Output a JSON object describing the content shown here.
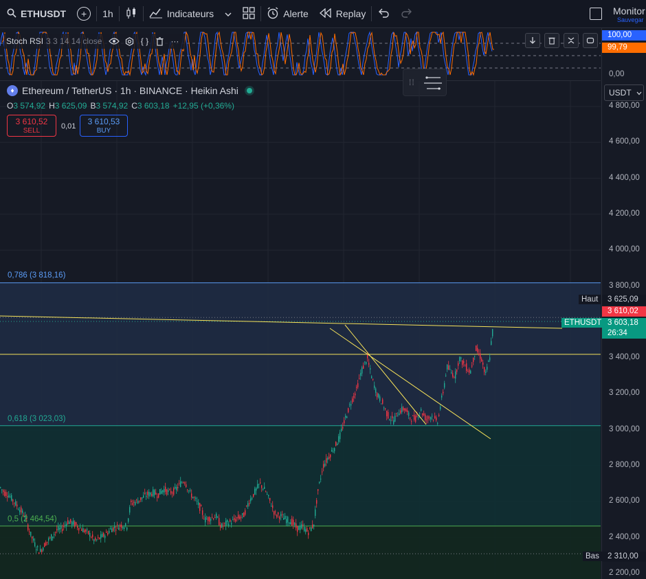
{
  "toolbar": {
    "symbol": "ETHUSDT",
    "interval": "1h",
    "indicators": "Indicateurs",
    "alert": "Alerte",
    "replay": "Replay",
    "monitor": "Monitor",
    "save": "Sauvegar"
  },
  "rsi": {
    "name": "Stoch RSI",
    "params": "3 3 14 14 close",
    "value_k": "100,00",
    "value_d": "99,79",
    "zero": "0,00",
    "k_color": "#2962ff",
    "d_color": "#ff6d00"
  },
  "legend": {
    "title": "Ethereum / TetherUS · 1h · BINANCE · Heikin Ashi",
    "o_label": "O",
    "o": "3 574,92",
    "h_label": "H",
    "h": "3 625,09",
    "b_label": "B",
    "b": "3 574,92",
    "c_label": "C",
    "c": "3 603,18",
    "change": "+12,95 (+0,36%)"
  },
  "trade": {
    "sell_price": "3 610,52",
    "sell_label": "SELL",
    "spread": "0,01",
    "buy_price": "3 610,53",
    "buy_label": "BUY"
  },
  "axis": {
    "currency": "USDT",
    "ticks": [
      "4 800,00",
      "4 600,00",
      "4 400,00",
      "4 200,00",
      "4 000,00",
      "3 800,00",
      "3 400,00",
      "3 200,00",
      "3 000,00",
      "2 800,00",
      "2 600,00",
      "2 400,00",
      "2 200,00"
    ],
    "high_label": "Haut",
    "high_value": "3 625,09",
    "ask_value": "3 610,02",
    "symbol_tag": "ETHUSDT",
    "last_value": "3 603,18",
    "countdown": "26:34",
    "low_label": "Bas",
    "low_value": "2 310,00"
  },
  "fib": {
    "l786": "0,786 (3 818,16)",
    "l618": "0,618 (3 023,03)",
    "l5": "0,5 (2 464,54)"
  },
  "colors": {
    "up": "#22ab94",
    "down": "#f23645",
    "trendline": "#f7e35a",
    "fib786": "#5b9cf6",
    "fib618": "#22ab94",
    "fib5": "#4caf50"
  },
  "chart_data": {
    "type": "candlestick",
    "series_points": [
      [
        0,
        2680
      ],
      [
        6,
        2650
      ],
      [
        12,
        2640
      ],
      [
        20,
        2600
      ],
      [
        28,
        2560
      ],
      [
        36,
        2520
      ],
      [
        44,
        2420
      ],
      [
        52,
        2350
      ],
      [
        58,
        2320
      ],
      [
        66,
        2370
      ],
      [
        74,
        2400
      ],
      [
        82,
        2440
      ],
      [
        90,
        2450
      ],
      [
        98,
        2490
      ],
      [
        106,
        2480
      ],
      [
        114,
        2460
      ],
      [
        122,
        2440
      ],
      [
        130,
        2420
      ],
      [
        138,
        2380
      ],
      [
        146,
        2400
      ],
      [
        154,
        2420
      ],
      [
        162,
        2450
      ],
      [
        170,
        2460
      ],
      [
        178,
        2470
      ],
      [
        184,
        2460
      ],
      [
        190,
        2590
      ],
      [
        198,
        2600
      ],
      [
        206,
        2620
      ],
      [
        214,
        2640
      ],
      [
        222,
        2650
      ],
      [
        230,
        2640
      ],
      [
        238,
        2670
      ],
      [
        246,
        2650
      ],
      [
        254,
        2660
      ],
      [
        262,
        2700
      ],
      [
        268,
        2720
      ],
      [
        276,
        2650
      ],
      [
        284,
        2610
      ],
      [
        292,
        2560
      ],
      [
        298,
        2500
      ],
      [
        306,
        2510
      ],
      [
        314,
        2520
      ],
      [
        322,
        2460
      ],
      [
        330,
        2480
      ],
      [
        338,
        2490
      ],
      [
        346,
        2510
      ],
      [
        354,
        2520
      ],
      [
        362,
        2600
      ],
      [
        370,
        2650
      ],
      [
        378,
        2700
      ],
      [
        386,
        2660
      ],
      [
        394,
        2590
      ],
      [
        400,
        2530
      ],
      [
        408,
        2520
      ],
      [
        416,
        2500
      ],
      [
        424,
        2490
      ],
      [
        432,
        2450
      ],
      [
        440,
        2460
      ],
      [
        448,
        2430
      ],
      [
        456,
        2470
      ],
      [
        462,
        2650
      ],
      [
        470,
        2800
      ],
      [
        478,
        2850
      ],
      [
        486,
        2900
      ],
      [
        494,
        2960
      ],
      [
        502,
        3060
      ],
      [
        510,
        3150
      ],
      [
        518,
        3220
      ],
      [
        526,
        3330
      ],
      [
        534,
        3400
      ],
      [
        540,
        3300
      ],
      [
        548,
        3200
      ],
      [
        556,
        3150
      ],
      [
        564,
        3080
      ],
      [
        572,
        3050
      ],
      [
        580,
        3100
      ],
      [
        588,
        3120
      ],
      [
        596,
        3070
      ],
      [
        604,
        3060
      ],
      [
        612,
        3110
      ],
      [
        620,
        3060
      ],
      [
        628,
        3080
      ],
      [
        636,
        3040
      ],
      [
        644,
        3200
      ],
      [
        650,
        3350
      ],
      [
        656,
        3320
      ],
      [
        662,
        3300
      ],
      [
        668,
        3400
      ],
      [
        676,
        3360
      ],
      [
        684,
        3320
      ],
      [
        692,
        3450
      ],
      [
        700,
        3400
      ],
      [
        706,
        3300
      ],
      [
        712,
        3400
      ],
      [
        718,
        3600
      ]
    ],
    "ylim": [
      2200,
      4880
    ],
    "fib_levels": [
      3818.16,
      3023.03,
      2464.54
    ],
    "horizontal_lines": [
      3420
    ]
  }
}
